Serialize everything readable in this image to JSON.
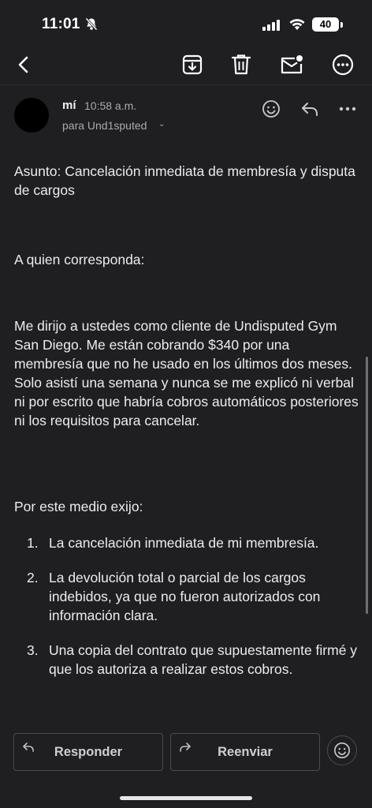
{
  "status_bar": {
    "time": "11:01",
    "battery": "40",
    "icons": [
      "bell-slash-icon",
      "cellular-signal-icon",
      "wifi-icon",
      "battery-icon"
    ]
  },
  "toolbar": {
    "icons": [
      "back-icon",
      "archive-icon",
      "trash-icon",
      "mark-unread-icon",
      "more-icon"
    ]
  },
  "email": {
    "sender": "mí",
    "time": "10:58 a.m.",
    "recipient": "para Und1sputed",
    "header_icons": [
      "emoji-reaction-icon",
      "reply-icon",
      "more-horizontal-icon"
    ],
    "subject_line": "Asunto: Cancelación inmediata de membresía y disputa de cargos",
    "greeting": "A quien corresponda:",
    "paragraph": "Me dirijo a ustedes como cliente de Undisputed Gym San Diego. Me están cobrando $340 por una membresía que no he usado en los últimos dos meses. Solo asistí una semana y nunca se me explicó ni verbal ni por escrito que habría cobros automáticos posteriores ni los requisitos para cancelar.",
    "demand_intro": "Por este medio exijo:",
    "demands": [
      {
        "num": "1.",
        "text": "La cancelación inmediata de mi membresía."
      },
      {
        "num": "2.",
        "text": "La devolución total o parcial de los cargos indebidos, ya que no fueron autorizados con información clara."
      },
      {
        "num": "3.",
        "text": "Una copia del contrato que supuestamente firmé y que los autoriza a realizar estos cobros."
      }
    ]
  },
  "actions": {
    "reply_label": "Responder",
    "forward_label": "Reenviar"
  }
}
